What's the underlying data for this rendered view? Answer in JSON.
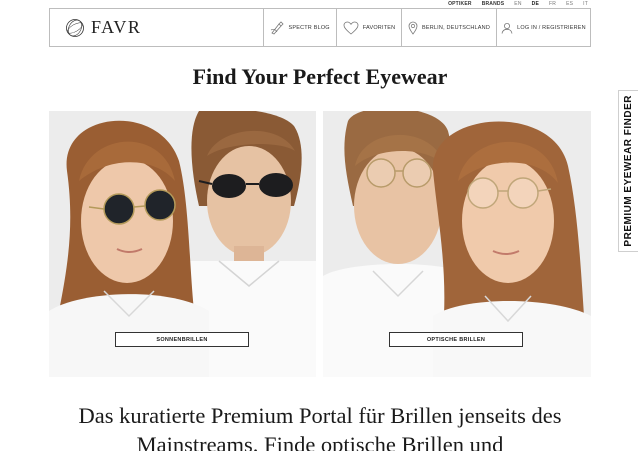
{
  "top_nav": {
    "optiker": "OPTIKER",
    "brands": "BRANDS",
    "languages": [
      "EN",
      "DE",
      "FR",
      "ES",
      "IT"
    ]
  },
  "header": {
    "logo_text": "FAVR",
    "blog": "SPECTR BLOG",
    "favorites": "FAVORITEN",
    "location": "BERLIN, DEUTSCHLAND",
    "login": "LOG IN / REGISTRIEREN"
  },
  "side_tab": "PREMIUM EYEWEAR FINDER",
  "main": {
    "title": "Find Your Perfect Eyewear",
    "panels": [
      {
        "label": "SONNENBRILLEN"
      },
      {
        "label": "OPTISCHE BRILLEN"
      }
    ],
    "tagline": "Das kuratierte Premium Portal für Brillen jenseits des Mainstreams. Finde optische Brillen und"
  },
  "icons": {
    "blog": "brush-icon",
    "favorites": "heart-icon",
    "location": "location-pin-icon",
    "login": "user-icon"
  },
  "colors": {
    "border": "#bdbdbd",
    "text": "#1a1a1a",
    "background": "#ffffff"
  }
}
